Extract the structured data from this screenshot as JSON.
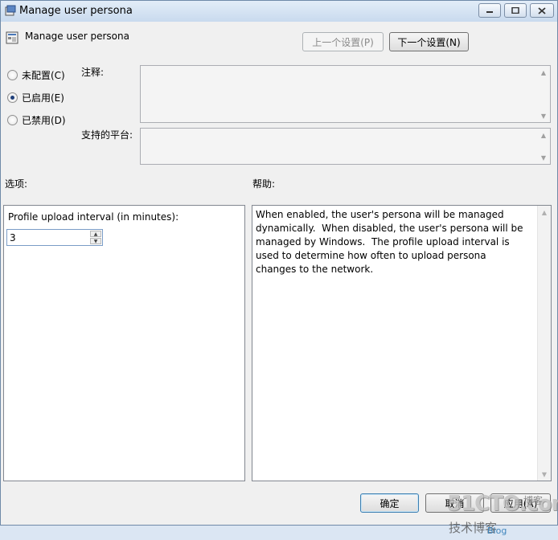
{
  "window": {
    "title": "Manage user persona"
  },
  "header": {
    "policy_title": "Manage user persona",
    "prev_label": "上一个设置(P)",
    "next_label": "下一个设置(N)"
  },
  "state": {
    "options": [
      {
        "label": "未配置(C)",
        "selected": false
      },
      {
        "label": "已启用(E)",
        "selected": true
      },
      {
        "label": "已禁用(D)",
        "selected": false
      }
    ]
  },
  "comment": {
    "label": "注释:",
    "value": ""
  },
  "platform": {
    "label": "支持的平台:",
    "value": ""
  },
  "options_panel": {
    "label": "选项:",
    "field_label": "Profile upload interval (in minutes):",
    "field_value": "3"
  },
  "help_panel": {
    "label": "帮助:",
    "text": "When enabled, the user's persona will be managed dynamically.  When disabled, the user's persona will be managed by Windows.  The profile upload interval is used to determine how often to upload persona changes to the network."
  },
  "footer": {
    "ok_label": "确定",
    "cancel_label": "取消",
    "apply_label": "应用(A)"
  },
  "watermark": {
    "site": "51CTO.com",
    "blog": "博客",
    "tagline": "技术博客",
    "url": "Blog"
  }
}
